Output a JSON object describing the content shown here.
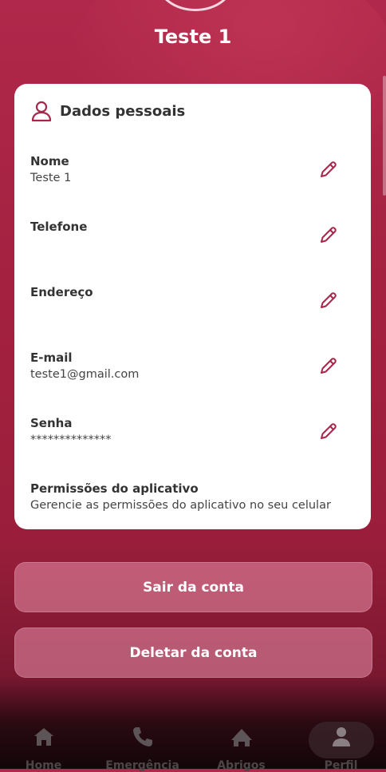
{
  "profile": {
    "name": "Teste 1"
  },
  "card": {
    "title": "Dados pessoais",
    "fields": [
      {
        "label": "Nome",
        "value": "Teste 1"
      },
      {
        "label": "Telefone",
        "value": ""
      },
      {
        "label": "Endereço",
        "value": ""
      },
      {
        "label": "E-mail",
        "value": "teste1@gmail.com"
      },
      {
        "label": "Senha",
        "value": "**************"
      }
    ],
    "permissions": {
      "label": "Permissões do aplicativo",
      "description": "Gerencie as permissões do aplicativo no seu celular"
    }
  },
  "actions": {
    "logout": "Sair da conta",
    "delete": "Deletar da conta"
  },
  "nav": {
    "items": [
      {
        "label": "Home",
        "icon": "home-icon"
      },
      {
        "label": "Emergência",
        "icon": "phone-icon"
      },
      {
        "label": "Abrigos",
        "icon": "shelter-icon"
      },
      {
        "label": "Perfil",
        "icon": "person-icon"
      }
    ]
  },
  "colors": {
    "accent": "#a8264a",
    "card": "#ffffff",
    "button": "#d98aa1"
  }
}
